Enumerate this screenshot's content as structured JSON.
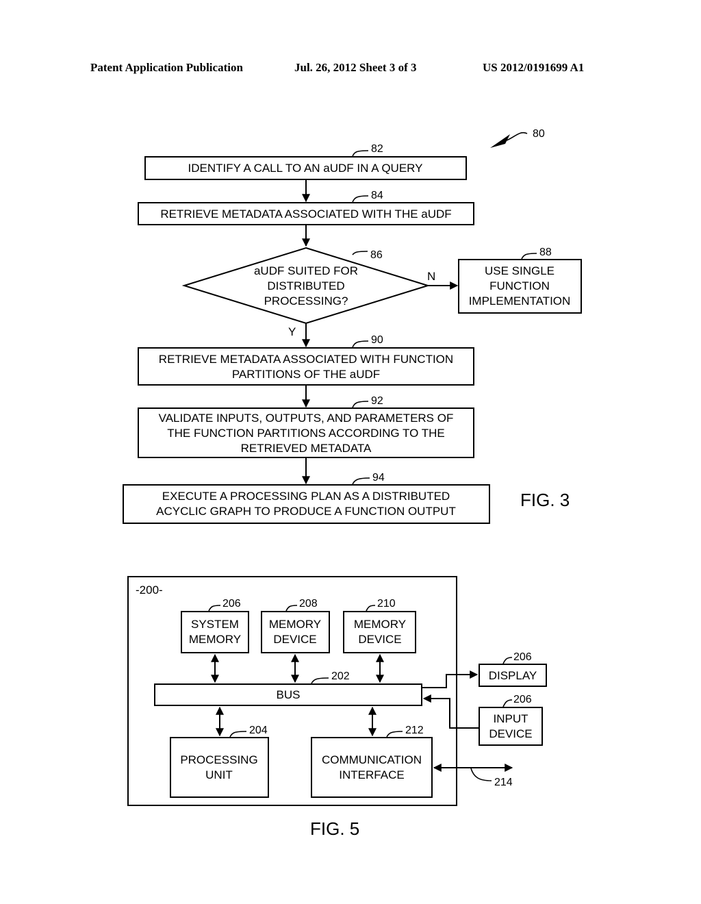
{
  "header": {
    "publication": "Patent Application Publication",
    "date_sheet": "Jul. 26, 2012   Sheet 3 of 3",
    "patent_number": "US 2012/0191699 A1"
  },
  "fig3": {
    "label": "FIG. 3",
    "ref": "80",
    "steps": [
      {
        "ref": "82",
        "lines": [
          "IDENTIFY A CALL TO AN aUDF IN A QUERY"
        ]
      },
      {
        "ref": "84",
        "lines": [
          "RETRIEVE METADATA ASSOCIATED WITH THE aUDF"
        ]
      },
      {
        "ref": "86",
        "lines": [
          "aUDF SUITED FOR",
          "DISTRIBUTED",
          "PROCESSING?"
        ]
      },
      {
        "ref": "88",
        "lines": [
          "USE SINGLE",
          "FUNCTION",
          "IMPLEMENTATION"
        ]
      },
      {
        "ref": "90",
        "lines": [
          "RETRIEVE METADATA ASSOCIATED WITH FUNCTION",
          "PARTITIONS OF THE aUDF"
        ]
      },
      {
        "ref": "92",
        "lines": [
          "VALIDATE INPUTS, OUTPUTS, AND PARAMETERS OF",
          "THE FUNCTION PARTITIONS ACCORDING TO THE",
          "RETRIEVED METADATA"
        ]
      },
      {
        "ref": "94",
        "lines": [
          "EXECUTE A PROCESSING PLAN AS A DISTRIBUTED",
          "ACYCLIC GRAPH TO PRODUCE A FUNCTION OUTPUT"
        ]
      }
    ],
    "branch_no": "N",
    "branch_yes": "Y"
  },
  "fig5": {
    "label": "FIG. 5",
    "system_label": "-200-",
    "system_memory": {
      "ref": "206",
      "lines": [
        "SYSTEM",
        "MEMORY"
      ]
    },
    "memory_device_1": {
      "ref": "208",
      "lines": [
        "MEMORY",
        "DEVICE"
      ]
    },
    "memory_device_2": {
      "ref": "210",
      "lines": [
        "MEMORY",
        "DEVICE"
      ]
    },
    "bus": {
      "ref": "202",
      "label": "BUS"
    },
    "processing_unit": {
      "ref": "204",
      "lines": [
        "PROCESSING",
        "UNIT"
      ]
    },
    "communication_interface": {
      "ref": "212",
      "lines": [
        "COMMUNICATION",
        "INTERFACE"
      ]
    },
    "display": {
      "ref": "206",
      "label": "DISPLAY"
    },
    "input_device": {
      "ref": "206",
      "lines": [
        "INPUT",
        "DEVICE"
      ]
    },
    "network_ref": "214"
  }
}
